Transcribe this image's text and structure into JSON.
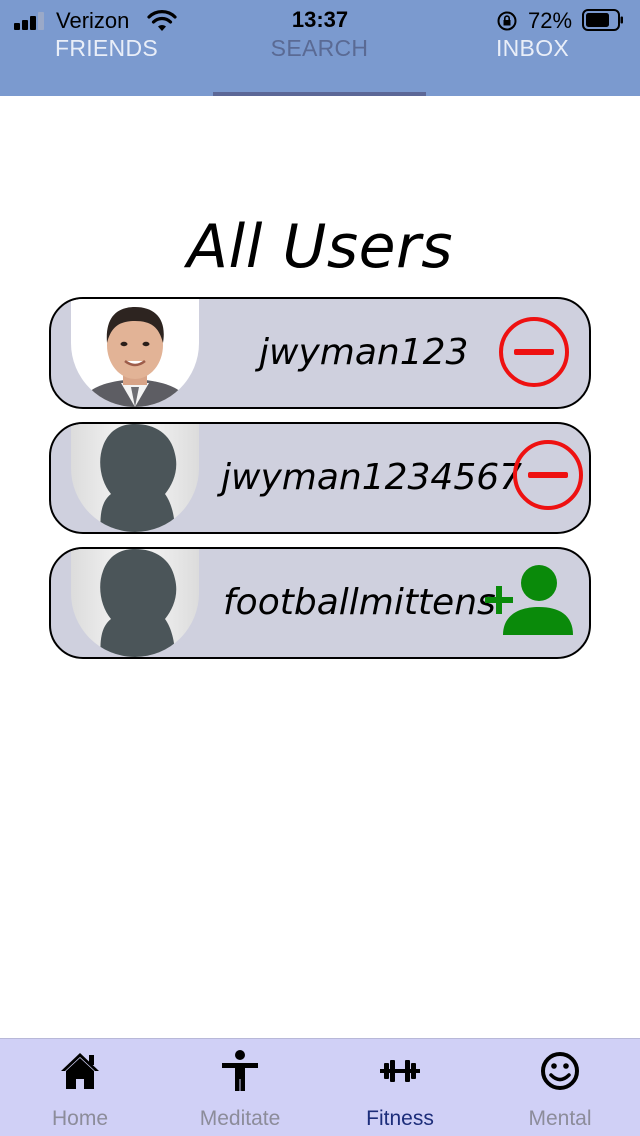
{
  "status_bar": {
    "carrier": "Verizon",
    "time": "13:37",
    "battery_percent": "72%",
    "icons": [
      "signal-icon",
      "wifi-icon",
      "rotation-lock-icon",
      "battery-icon"
    ]
  },
  "tabs": [
    {
      "label": "FRIENDS",
      "active": false
    },
    {
      "label": "SEARCH",
      "active": true
    },
    {
      "label": "INBOX",
      "active": false
    }
  ],
  "page_title": "All Users",
  "users": [
    {
      "username": "jwyman123",
      "avatar": "photo",
      "action": "remove-friend-icon"
    },
    {
      "username": "jwyman1234567",
      "avatar": "silhouette",
      "action": "remove-friend-icon"
    },
    {
      "username": "footballmittens",
      "avatar": "silhouette",
      "action": "add-friend-icon"
    }
  ],
  "bottom_nav": [
    {
      "label": "Home",
      "icon": "home-icon",
      "active": false
    },
    {
      "label": "Meditate",
      "icon": "meditate-icon",
      "active": false
    },
    {
      "label": "Fitness",
      "icon": "dumbbell-icon",
      "active": true
    },
    {
      "label": "Mental",
      "icon": "smiley-icon",
      "active": false
    }
  ],
  "colors": {
    "header": "#7b9acf",
    "card": "#cfd0de",
    "remove": "#ee1111",
    "add": "#0a8a0a",
    "nav_bg": "#d0d0f6",
    "nav_active": "#1c2d7a"
  }
}
